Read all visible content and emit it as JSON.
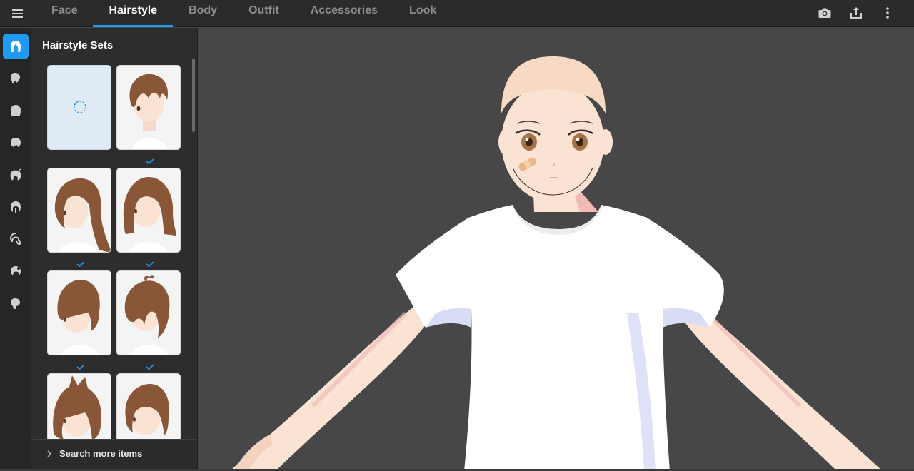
{
  "topbar": {
    "tabs": [
      "Face",
      "Hairstyle",
      "Body",
      "Outfit",
      "Accessories",
      "Look"
    ],
    "active_tab": "Hairstyle",
    "icons": [
      "camera-icon",
      "share-icon",
      "more-vertical-icon"
    ]
  },
  "rail": {
    "items": [
      "hair-set-icon",
      "front-hair-icon",
      "back-hair-icon",
      "side-hair-icon",
      "ahoge-icon",
      "hair-extension-icon",
      "hair-tail-icon",
      "hair-accent-icon",
      "hair-base-icon"
    ],
    "active_index": 0
  },
  "panel": {
    "title": "Hairstyle Sets",
    "cards": [
      {
        "style": "none",
        "selected": false
      },
      {
        "style": "short-boy",
        "selected": true
      },
      {
        "style": "long-straight",
        "selected": true
      },
      {
        "style": "medium-bob",
        "selected": true
      },
      {
        "style": "bowl-cut",
        "selected": true
      },
      {
        "style": "messy-short",
        "selected": true
      },
      {
        "style": "cat-ears",
        "selected": false
      },
      {
        "style": "short-bob",
        "selected": false
      }
    ],
    "search_more_label": "Search more items"
  },
  "colors": {
    "accent": "#1e9af5",
    "topbar_bg": "#2b2b2b",
    "panel_bg": "#2d2d2d",
    "viewport_bg": "#474747",
    "hair": "#8a5638"
  }
}
